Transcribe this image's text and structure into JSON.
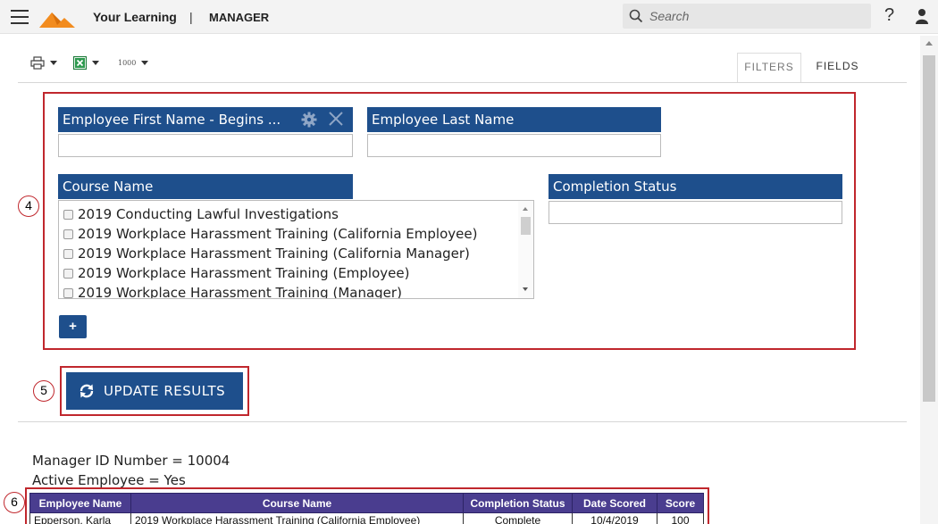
{
  "header": {
    "title": "Your Learning",
    "separator": "|",
    "role": "MANAGER",
    "search_placeholder": "Search",
    "help_label": "?",
    "logo_color": "#f28c1f"
  },
  "toolbar": {
    "print_icon": "printer-icon",
    "excel_icon": "excel-icon",
    "page_size_label": "1000"
  },
  "tabs": [
    {
      "label": "FILTERS",
      "active": true
    },
    {
      "label": "FIELDS",
      "active": false
    }
  ],
  "callouts": [
    "4",
    "5",
    "6"
  ],
  "filters": {
    "first_name": {
      "label": "Employee First Name - Begins ...",
      "value": ""
    },
    "last_name": {
      "label": "Employee Last Name",
      "value": ""
    },
    "course_name": {
      "label": "Course Name",
      "options": [
        "2019 Conducting Lawful Investigations",
        "2019 Workplace Harassment Training (California Employee)",
        "2019 Workplace Harassment Training (California Manager)",
        "2019 Workplace Harassment Training (Employee)",
        "2019 Workplace Harassment Training (Manager)"
      ]
    },
    "completion_status": {
      "label": "Completion Status",
      "value": ""
    },
    "add_label": "+"
  },
  "update_button": {
    "label": "UPDATE RESULTS"
  },
  "criteria": {
    "manager_id": "Manager ID Number = 10004",
    "active_employee": "Active Employee = Yes"
  },
  "results": {
    "columns": [
      "Employee Name",
      "Course Name",
      "Completion Status",
      "Date Scored",
      "Score"
    ],
    "rows": [
      [
        "Epperson, Karla",
        "2019 Workplace Harassment Training (California Employee)",
        "Complete",
        "10/4/2019",
        "100"
      ]
    ]
  },
  "colors": {
    "primary": "#1e4f8c",
    "table_header": "#4a3d8f",
    "callout_red": "#c0272d"
  }
}
